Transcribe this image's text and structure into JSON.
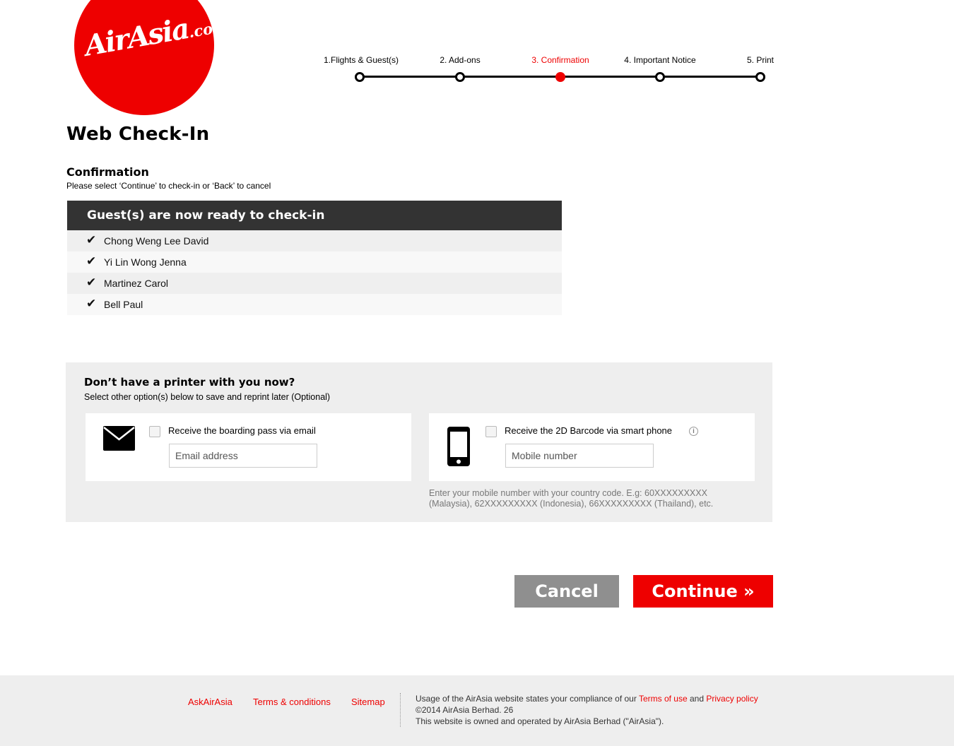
{
  "brand": {
    "logo_main": "AirAsia",
    "logo_suffix": ".com",
    "accent_color": "#ee0000"
  },
  "steps": [
    {
      "label": "1.Flights & Guest(s)",
      "active": false
    },
    {
      "label": "2. Add-ons",
      "active": false
    },
    {
      "label": "3. Confirmation",
      "active": true
    },
    {
      "label": "4. Important Notice",
      "active": false
    },
    {
      "label": "5. Print",
      "active": false
    }
  ],
  "page": {
    "title": "Web Check-In",
    "section_title": "Confirmation",
    "section_subtitle": "Please select ‘Continue’ to check-in or ‘Back’ to cancel"
  },
  "guests": {
    "header": "Guest(s) are now ready to check-in",
    "check_icon": "checkmark-icon",
    "names": [
      "Chong Weng Lee David",
      "Yi Lin Wong Jenna",
      "Martinez Carol",
      "Bell Paul"
    ]
  },
  "printer": {
    "title": "Don’t have a printer with you now?",
    "subtitle": "Select other option(s) below to save and reprint later (Optional)",
    "email_option": {
      "icon": "envelope-icon",
      "label": "Receive the boarding pass via email",
      "placeholder": "Email address",
      "checked": false
    },
    "sms_option": {
      "icon": "smartphone-icon",
      "label": "Receive the 2D Barcode via smart phone",
      "placeholder": "Mobile number",
      "checked": false,
      "info_icon": "info-icon"
    },
    "hint_line1": "Enter your mobile number with your country code. E.g: 60XXXXXXXXX",
    "hint_line2": "(Malaysia), 62XXXXXXXXX (Indonesia), 66XXXXXXXXX (Thailand), etc."
  },
  "buttons": {
    "cancel": "Cancel",
    "continue": "Continue »"
  },
  "footer": {
    "links": [
      "AskAirAsia",
      "Terms & conditions",
      "Sitemap"
    ],
    "usage_prefix": "Usage of the AirAsia website states your compliance of our ",
    "terms_link": "Terms of use",
    "and": " and ",
    "privacy_link": "Privacy policy",
    "copyright": "©2014 AirAsia Berhad. 26",
    "owned": "This website is owned and operated by AirAsia Berhad (\"AirAsia\")."
  }
}
